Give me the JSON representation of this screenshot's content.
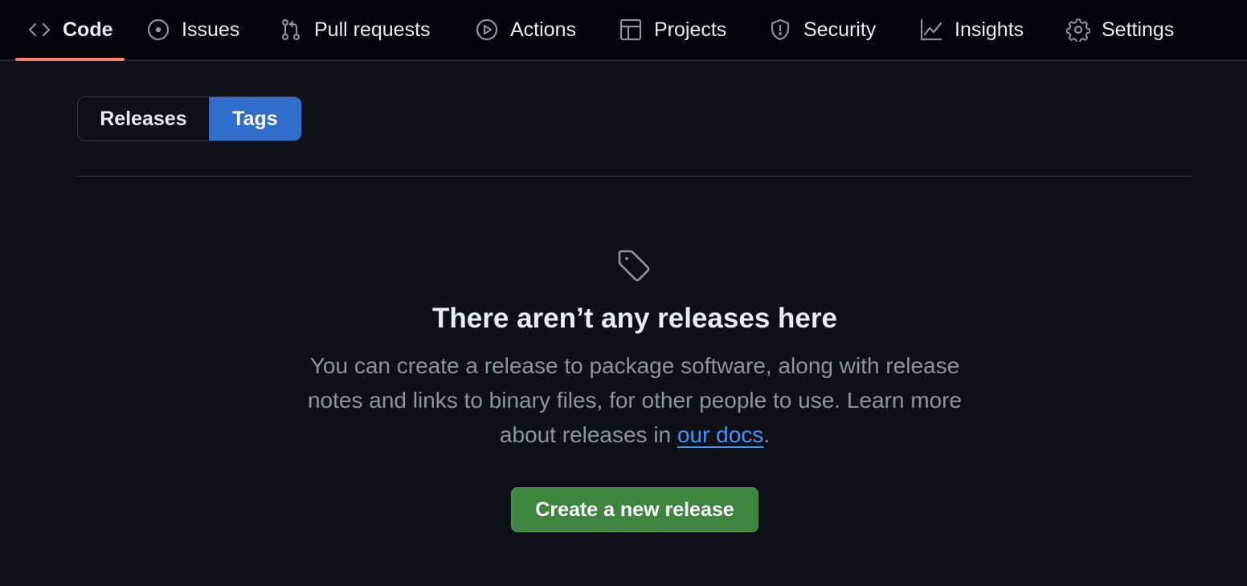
{
  "repo_nav": {
    "items": [
      {
        "label": "Code",
        "icon": "code-icon"
      },
      {
        "label": "Issues",
        "icon": "issue-opened-icon"
      },
      {
        "label": "Pull requests",
        "icon": "git-pull-request-icon"
      },
      {
        "label": "Actions",
        "icon": "play-icon"
      },
      {
        "label": "Projects",
        "icon": "table-icon"
      },
      {
        "label": "Security",
        "icon": "shield-icon"
      },
      {
        "label": "Insights",
        "icon": "graph-icon"
      },
      {
        "label": "Settings",
        "icon": "gear-icon"
      }
    ],
    "selected": "Code"
  },
  "toggle": {
    "releases_label": "Releases",
    "tags_label": "Tags",
    "selected": "Tags"
  },
  "blank_slate": {
    "icon": "tag-icon",
    "title": "There aren’t any releases here",
    "description_before_link": "You can create a release to package software, along with release notes and links to binary files, for other people to use. Learn more about releases in ",
    "link_text": "our docs",
    "description_after_link": ".",
    "button_label": "Create a new release"
  },
  "colors": {
    "background": "#0d1117",
    "nav_background": "#010409",
    "active_underline": "#f78166",
    "selected_toggle": "#316dca",
    "primary_button": "#3e8640",
    "link": "#4493f8",
    "muted_text": "#8b949e"
  }
}
